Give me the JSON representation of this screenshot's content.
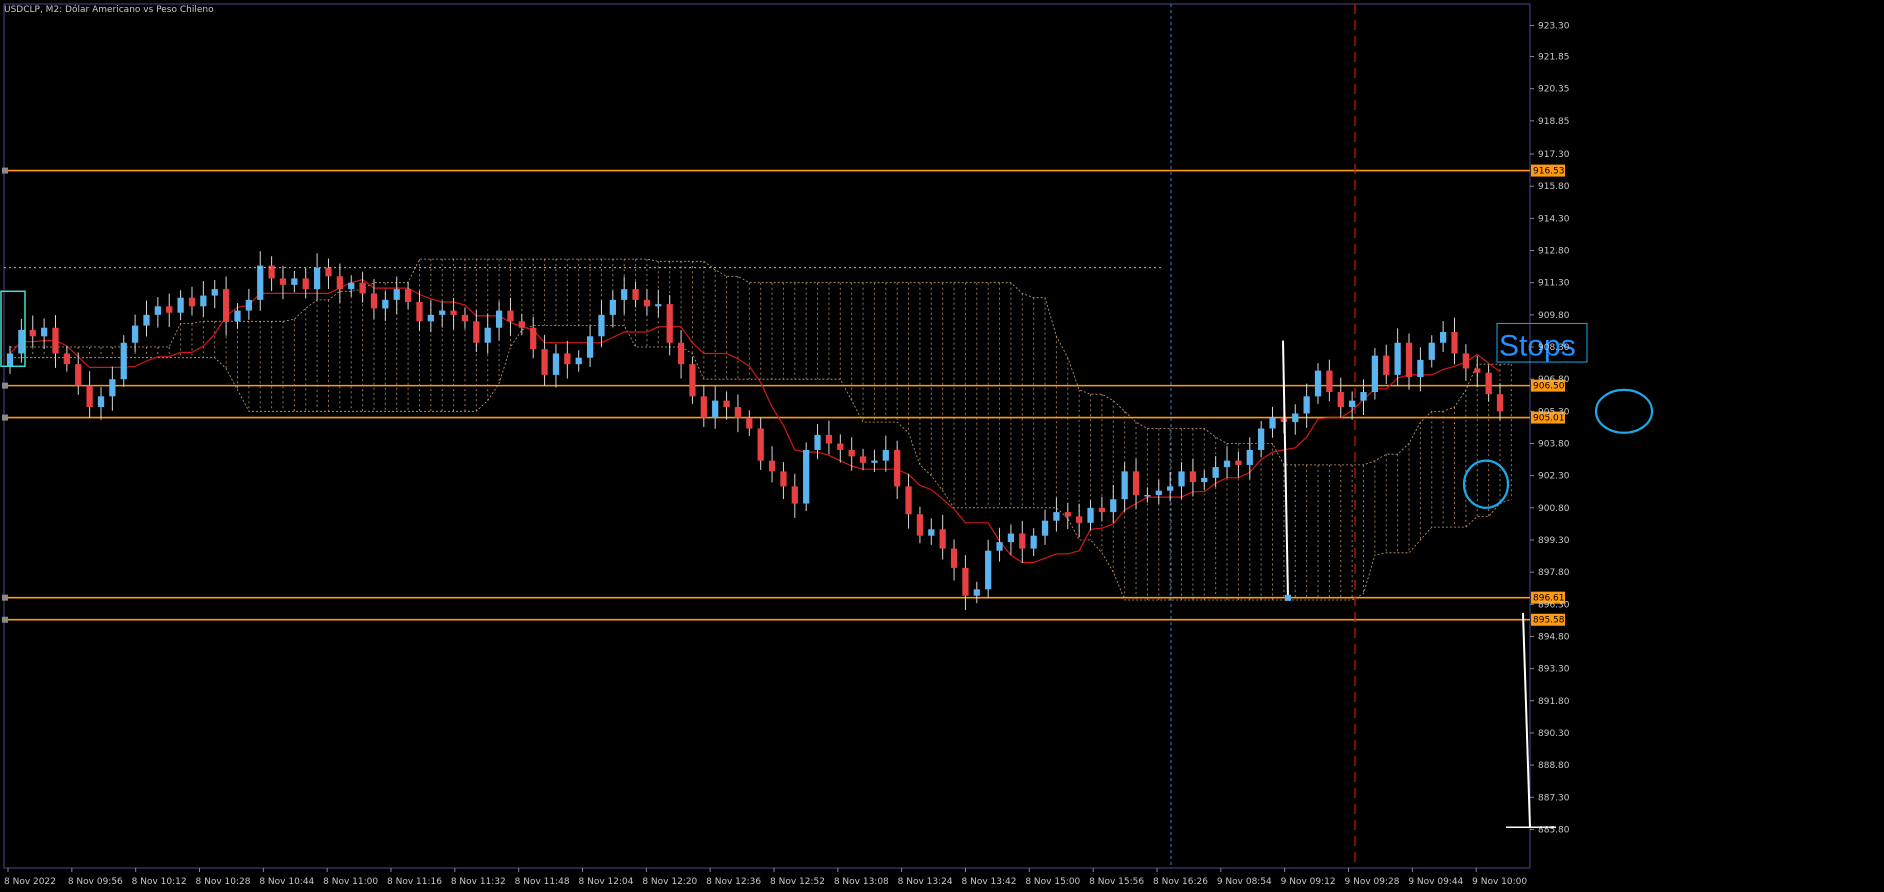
{
  "window": {
    "title": "USDCLP, M2:  Dólar Americano vs Peso Chileno"
  },
  "colors": {
    "background": "#000000",
    "grid": "#2a2a2a",
    "axis": "#4a4a8a",
    "bull": "#5ab4f0",
    "bear": "#e84040",
    "kijun": "#d01818",
    "cloud": "#c8a070",
    "level": "#ff9a10",
    "annotation": "#1ea8e8",
    "marker": "#ffffff",
    "vline_blue": "#4a78c8",
    "vline_red": "#d01818"
  },
  "chart_data": {
    "type": "candlestick",
    "symbol": "USDCLP",
    "timeframe": "M2",
    "title": "USDCLP, M2:  Dólar Americano vs Peso Chileno",
    "ylim": [
      884.0,
      924.3
    ],
    "y_ticks": [
      "923.30",
      "921.85",
      "920.35",
      "918.85",
      "917.30",
      "915.80",
      "914.30",
      "912.80",
      "911.30",
      "909.80",
      "908.30",
      "906.80",
      "905.30",
      "903.80",
      "902.30",
      "900.80",
      "899.30",
      "897.80",
      "896.30",
      "894.80",
      "893.30",
      "891.80",
      "890.30",
      "888.80",
      "887.30",
      "885.80"
    ],
    "x_labels": [
      "8 Nov 2022",
      "8 Nov 09:56",
      "8 Nov 10:12",
      "8 Nov 10:28",
      "8 Nov 10:44",
      "8 Nov 11:00",
      "8 Nov 11:16",
      "8 Nov 11:32",
      "8 Nov 11:48",
      "8 Nov 12:04",
      "8 Nov 12:20",
      "8 Nov 12:36",
      "8 Nov 12:52",
      "8 Nov 13:08",
      "8 Nov 13:24",
      "8 Nov 13:42",
      "8 Nov 15:00",
      "8 Nov 15:56",
      "8 Nov 16:26",
      "9 Nov 08:54",
      "9 Nov 09:12",
      "9 Nov 09:28",
      "9 Nov 09:44",
      "9 Nov 10:00"
    ],
    "candle_count": 132,
    "candles_close": [
      908.0,
      909.1,
      908.8,
      909.2,
      908.0,
      907.5,
      906.5,
      905.5,
      906.0,
      906.8,
      908.5,
      909.3,
      909.8,
      910.2,
      909.9,
      910.6,
      910.2,
      910.7,
      911.0,
      909.5,
      910.0,
      910.5,
      912.1,
      911.5,
      911.2,
      911.5,
      911.0,
      912.0,
      911.6,
      911.0,
      911.3,
      910.8,
      910.1,
      910.5,
      911.0,
      910.4,
      909.5,
      909.8,
      910.0,
      909.8,
      909.5,
      908.5,
      909.2,
      910.0,
      909.5,
      909.2,
      908.2,
      907.0,
      908.0,
      907.5,
      907.8,
      908.8,
      909.8,
      910.5,
      911.0,
      910.5,
      910.2,
      910.3,
      908.5,
      907.5,
      906.0,
      905.0,
      905.8,
      905.5,
      905.0,
      904.5,
      903.0,
      902.5,
      901.8,
      901.0,
      903.5,
      904.2,
      903.8,
      903.5,
      903.2,
      902.9,
      903.0,
      903.5,
      901.8,
      900.5,
      899.5,
      899.8,
      898.9,
      898.0,
      896.7,
      897.0,
      898.8,
      899.2,
      899.6,
      898.9,
      899.5,
      900.2,
      900.6,
      900.4,
      900.1,
      900.8,
      900.6,
      901.2,
      902.5,
      901.4,
      901.4,
      901.6,
      901.8,
      902.5,
      902.0,
      902.2,
      902.7,
      903.0,
      902.8,
      903.5,
      904.5,
      905.0,
      904.8,
      905.2,
      906.0,
      907.2,
      906.2,
      905.5,
      905.8,
      906.2,
      907.9,
      907.0,
      908.5,
      906.9,
      907.7,
      908.5,
      909.0,
      908.0,
      907.3,
      907.1,
      906.1,
      905.3
    ],
    "ichimoku": {
      "kijun": "red line",
      "kumo": "dotted tan cloud"
    },
    "levels": [
      {
        "value": 916.53,
        "label": "916.53"
      },
      {
        "value": 906.5,
        "label": "906.50"
      },
      {
        "value": 905.01,
        "label": "905.01"
      },
      {
        "value": 896.61,
        "label": "896.61"
      },
      {
        "value": 895.58,
        "label": "895.58"
      }
    ],
    "annotations": [
      {
        "text": "Stops"
      }
    ],
    "grid": false,
    "legend": "none"
  }
}
